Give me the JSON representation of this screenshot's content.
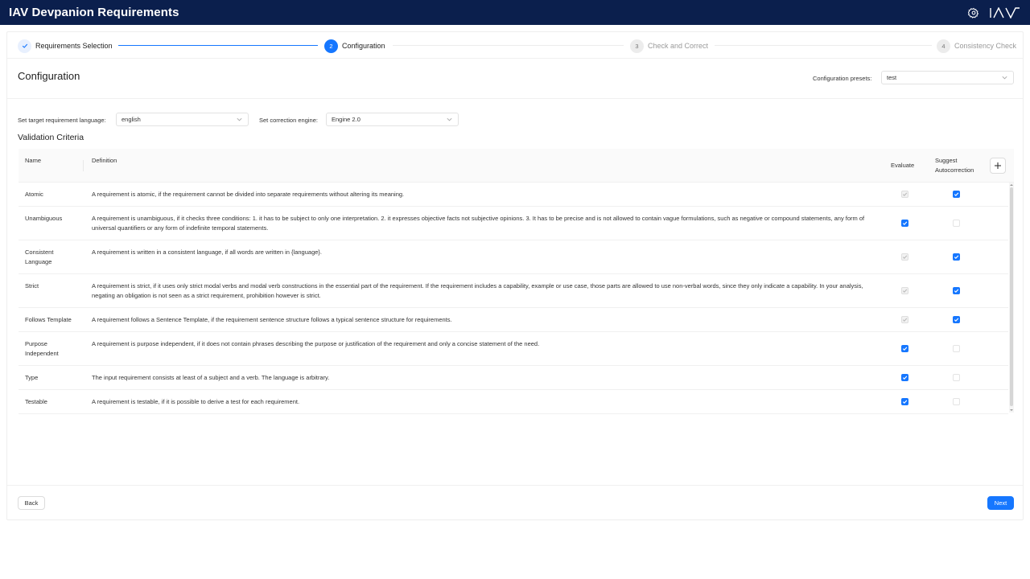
{
  "app": {
    "title": "IAV Devpanion Requirements",
    "logo_text": "IAV",
    "icons": [
      "gear-icon"
    ]
  },
  "steps": [
    {
      "number": "1",
      "label": "Requirements Selection",
      "status": "done"
    },
    {
      "number": "2",
      "label": "Configuration",
      "status": "active"
    },
    {
      "number": "3",
      "label": "Check and Correct",
      "status": "wait"
    },
    {
      "number": "4",
      "label": "Consistency Check",
      "status": "wait"
    }
  ],
  "page": {
    "title": "Configuration",
    "presets_label": "Configuration presets:",
    "presets_value": "test",
    "language_label": "Set target requirement language:",
    "language_value": "english",
    "engine_label": "Set correction engine:",
    "engine_value": "Engine 2.0",
    "criteria_title": "Validation Criteria"
  },
  "table": {
    "col_name": "Name",
    "col_definition": "Definition",
    "col_evaluate": "Evaluate",
    "col_suggest": "Suggest Autocorrection",
    "rows": [
      {
        "name": "Atomic",
        "definition": "A requirement is atomic, if the requirement cannot be divided into separate requirements without altering its meaning.",
        "evaluate": "checked-disabled",
        "suggest": "checked"
      },
      {
        "name": "Unambiguous",
        "definition": "A requirement is unambiguous, if it checks three conditions: 1. it has to be subject to only one interpretation. 2. it expresses objective facts not subjective opinions. 3. It has to be precise and is not allowed to contain vague formulations, such as negative or compound statements, any form of universal quantifiers or any form of indefinite temporal statements.",
        "evaluate": "checked",
        "suggest": "unchecked-disabled"
      },
      {
        "name": "Consistent Language",
        "definition": "A requirement is written in a consistent language, if all words are written in {language}.",
        "evaluate": "checked-disabled",
        "suggest": "checked"
      },
      {
        "name": "Strict",
        "definition": "A requirement is strict, if it uses only strict modal verbs and modal verb constructions in the essential part of the requirement. If the requirement includes a capability, example or use case, those parts are allowed to use non-verbal words, since they only indicate a capability. In your analysis, negating an obligation is not seen as a strict requirement, prohibition however is strict.",
        "evaluate": "checked-disabled",
        "suggest": "checked"
      },
      {
        "name": "Follows Template",
        "definition": "A requirement follows a Sentence Template, if the requirement sentence structure follows a typical sentence structure for requirements.",
        "evaluate": "checked-disabled",
        "suggest": "checked"
      },
      {
        "name": "Purpose Independent",
        "definition": "A requirement is purpose independent, if it does not contain phrases describing the purpose or justification of the requirement and only a concise statement of the need.",
        "evaluate": "checked",
        "suggest": "unchecked-disabled"
      },
      {
        "name": "Type",
        "definition": "The input requirement consists at least of a subject and a verb. The language is arbitrary.",
        "evaluate": "checked",
        "suggest": "unchecked-disabled"
      },
      {
        "name": "Testable",
        "definition": "A requirement is testable, if it is possible to derive a test for each requirement.",
        "evaluate": "checked",
        "suggest": "unchecked-disabled"
      }
    ]
  },
  "footer": {
    "back_label": "Back",
    "next_label": "Next"
  },
  "colors": {
    "header_bg": "#0b1f4d",
    "accent": "#1677ff"
  }
}
